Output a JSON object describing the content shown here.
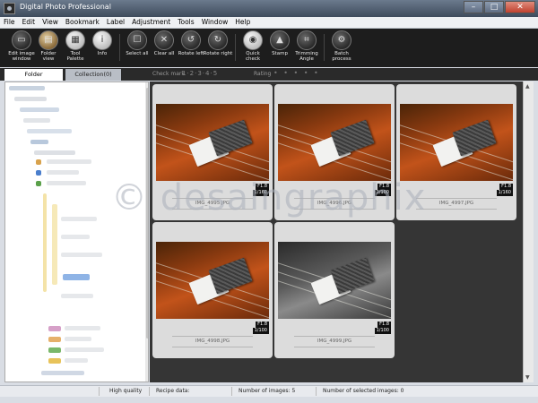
{
  "window": {
    "title": "Digital Photo Professional",
    "min": "–",
    "max": "□",
    "close": "✕"
  },
  "menu": [
    "File",
    "Edit",
    "View",
    "Bookmark",
    "Label",
    "Adjustment",
    "Tools",
    "Window",
    "Help"
  ],
  "toolbar": [
    {
      "label": "Edit image\nwindow",
      "icon": "edit-image-icon",
      "glyph": "▭"
    },
    {
      "label": "Folder\nview",
      "icon": "folder-view-icon",
      "glyph": "▤"
    },
    {
      "label": "Tool\nPalette",
      "icon": "tool-palette-icon",
      "glyph": "▦"
    },
    {
      "label": "Info",
      "icon": "info-icon",
      "glyph": "i"
    },
    {
      "label": "Select all",
      "icon": "select-all-icon",
      "glyph": "☐"
    },
    {
      "label": "Clear all",
      "icon": "clear-all-icon",
      "glyph": "✕"
    },
    {
      "label": "Rotate left",
      "icon": "rotate-left-icon",
      "glyph": "↺"
    },
    {
      "label": "Rotate right",
      "icon": "rotate-right-icon",
      "glyph": "↻"
    },
    {
      "label": "Quick\ncheck",
      "icon": "quick-check-icon",
      "glyph": "◉"
    },
    {
      "label": "Stamp",
      "icon": "stamp-icon",
      "glyph": "▲"
    },
    {
      "label": "Trimming\nAngle",
      "icon": "trimming-angle-icon",
      "glyph": "⌗"
    },
    {
      "label": "Batch\nprocess",
      "icon": "batch-process-icon",
      "glyph": "⚙"
    }
  ],
  "tabs": {
    "folder": "Folder",
    "collection": "Collection(0)"
  },
  "filters": {
    "checkmark_label": "Check mark",
    "checkmark_values": "1·2·3·4·5",
    "rating_label": "Rating",
    "rating_values": "• • • • •"
  },
  "images": [
    {
      "name": "IMG_4995.JPG",
      "aperture": "F1.8",
      "shutter": "1/160",
      "bw": false
    },
    {
      "name": "IMG_4996.JPG",
      "aperture": "F1.8",
      "shutter": "1/100",
      "bw": false
    },
    {
      "name": "IMG_4997.JPG",
      "aperture": "F1.8",
      "shutter": "1/160",
      "bw": false
    },
    {
      "name": "IMG_4998.JPG",
      "aperture": "F1.8",
      "shutter": "1/100",
      "bw": false
    },
    {
      "name": "IMG_4999.JPG",
      "aperture": "F1.8",
      "shutter": "1/100",
      "bw": true
    }
  ],
  "status": {
    "quality": "High quality",
    "recipe": "Recipe data:",
    "num_images": "Number of images: 5",
    "num_selected": "Number of selected images: 0"
  },
  "watermark": "© desaingraphix"
}
